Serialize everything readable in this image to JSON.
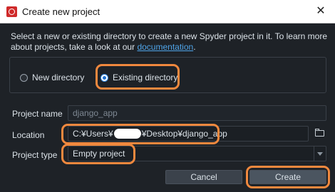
{
  "window": {
    "title": "Create new project",
    "close_glyph": "✕"
  },
  "intro": {
    "text": "Select a new or existing directory to create a new Spyder project in it. To learn more about projects, take a look at our ",
    "link": "documentation",
    "suffix": "."
  },
  "mode": {
    "new_label": "New directory",
    "existing_label": "Existing directory",
    "selected": "existing"
  },
  "form": {
    "project_name_label": "Project name",
    "project_name_value": "django_app",
    "location_label": "Location",
    "location_prefix": "C:¥Users¥",
    "location_suffix": "¥Desktop¥django_app",
    "project_type_label": "Project type",
    "project_type_value": "Empty project"
  },
  "buttons": {
    "cancel": "Cancel",
    "create": "Create"
  },
  "colors": {
    "highlight": "#f0883e",
    "link": "#4fa4e8",
    "background": "#1e2227"
  }
}
